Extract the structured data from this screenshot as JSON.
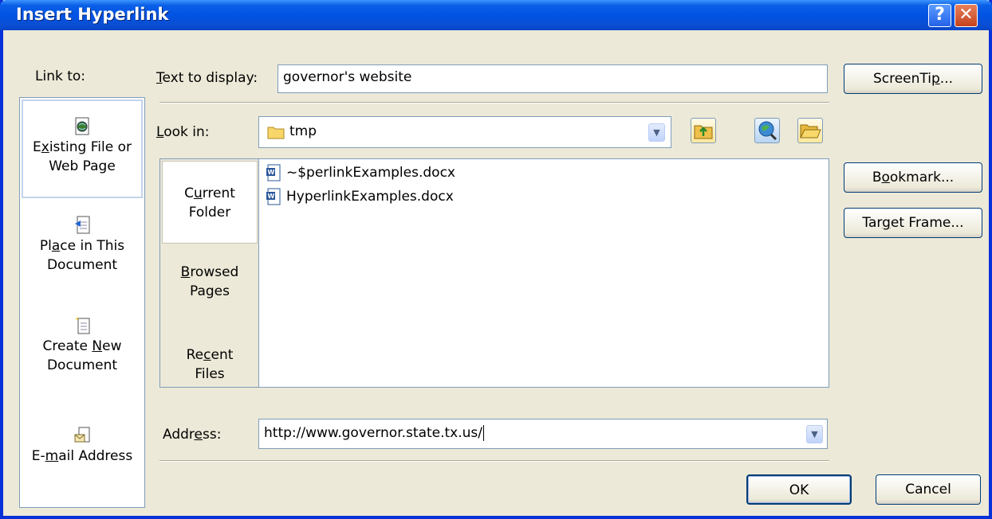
{
  "dialog": {
    "title": "Insert Hyperlink",
    "help_glyph": "?",
    "close_glyph": "✕"
  },
  "link_to": {
    "label": "Link to:",
    "items": [
      {
        "line1": "Existing File or",
        "line2": "Web Page",
        "icon": "existing-file-icon"
      },
      {
        "line1": "Place in This",
        "line2": "Document",
        "icon": "place-in-document-icon"
      },
      {
        "line1": "Create New",
        "line2": "Document",
        "icon": "create-new-document-icon"
      },
      {
        "line1": "E-mail Address",
        "line2": "",
        "icon": "email-address-icon"
      }
    ]
  },
  "text_to_display": {
    "label": "Text to display:",
    "value": "governor's website"
  },
  "screentip_label": "ScreenTip...",
  "look_in": {
    "label": "Look in:",
    "value": "tmp"
  },
  "tabs": [
    {
      "line1": "Current",
      "line2": "Folder"
    },
    {
      "line1": "Browsed",
      "line2": "Pages"
    },
    {
      "line1": "Recent",
      "line2": "Files"
    }
  ],
  "files": [
    "~$perlinkExamples.docx",
    "HyperlinkExamples.docx"
  ],
  "bookmark_label": "Bookmark...",
  "target_frame_label": "Target Frame...",
  "address": {
    "label": "Address:",
    "value": "http://www.governor.state.tx.us/"
  },
  "ok_label": "OK",
  "cancel_label": "Cancel"
}
